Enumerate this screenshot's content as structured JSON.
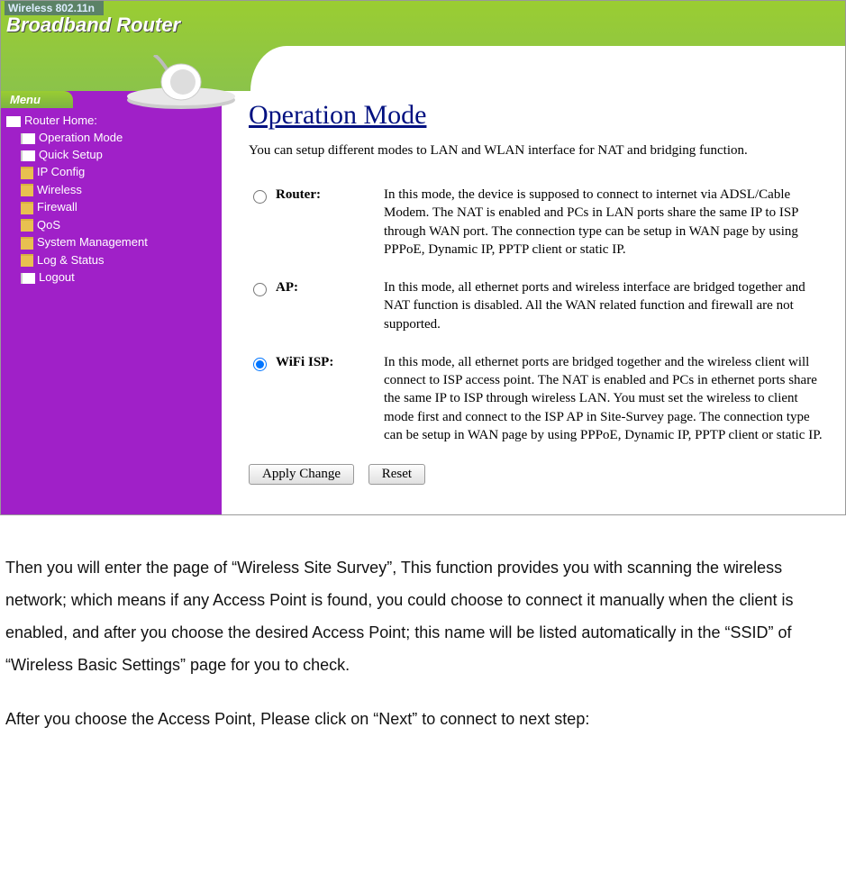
{
  "header": {
    "line1": "Wireless 802.11n",
    "line2": "Broadband Router"
  },
  "sidebar": {
    "menu_tab": "Menu",
    "root_label": "Router Home:",
    "items": [
      {
        "label": "Operation Mode",
        "icon": "page"
      },
      {
        "label": "Quick Setup",
        "icon": "page"
      },
      {
        "label": "IP Config",
        "icon": "folder"
      },
      {
        "label": "Wireless",
        "icon": "folder"
      },
      {
        "label": "Firewall",
        "icon": "folder"
      },
      {
        "label": "QoS",
        "icon": "folder"
      },
      {
        "label": "System Management",
        "icon": "folder"
      },
      {
        "label": "Log & Status",
        "icon": "folder"
      },
      {
        "label": "Logout",
        "icon": "page"
      }
    ]
  },
  "content": {
    "title": "Operation Mode",
    "intro": "You can setup different modes to LAN and WLAN interface for NAT and bridging function.",
    "modes": [
      {
        "value": "router",
        "label": "Router:",
        "selected": false,
        "description": "In this mode, the device is supposed to connect to internet via ADSL/Cable Modem. The NAT is enabled and PCs in LAN ports share the same IP to ISP through WAN port. The connection type can be setup in WAN page by using PPPoE, Dynamic IP, PPTP client or static IP."
      },
      {
        "value": "ap",
        "label": "AP:",
        "selected": false,
        "description": "In this mode, all ethernet ports and wireless interface are bridged together and NAT function is disabled. All the WAN related function and firewall are not supported."
      },
      {
        "value": "wifi_isp",
        "label": "WiFi ISP:",
        "selected": true,
        "description": "In this mode, all ethernet ports are bridged together and the wireless client will connect to ISP access point. The NAT is enabled and PCs in ethernet ports share the same IP to ISP through wireless LAN. You must set the wireless to client mode first and connect to the ISP AP in Site-Survey page. The connection type can be setup in WAN page by using PPPoE, Dynamic IP, PPTP client or static IP."
      }
    ],
    "buttons": {
      "apply": "Apply Change",
      "reset": "Reset"
    }
  },
  "doc": {
    "p1": "Then you will enter the page of “Wireless Site Survey”, This function provides you with scanning the wireless network; which means if any Access Point is found, you could choose to connect it manually when the client is enabled, and after you choose the desired Access Point; this name will be listed automatically in the “SSID” of “Wireless Basic Settings” page for you to check.",
    "p2": "After you choose the Access Point, Please click on “Next” to connect to next step:"
  }
}
